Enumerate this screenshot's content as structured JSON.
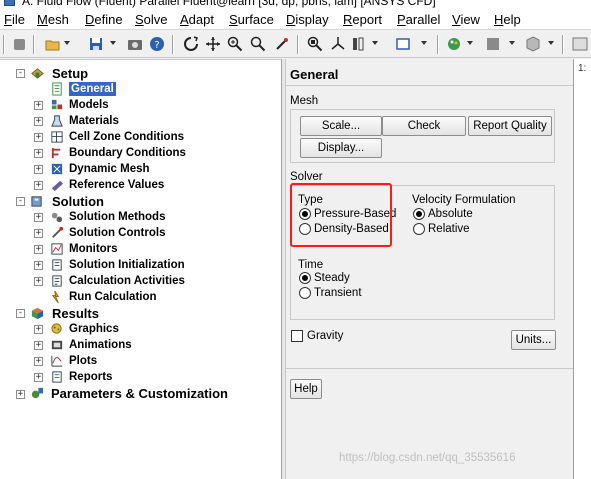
{
  "window": {
    "title": "A: Fluid Flow (Fluent) Parallel Fluent@learn [3d, dp, pbns, lam] [ANSYS CFD]"
  },
  "menubar": {
    "items": [
      {
        "label": "File",
        "ul": "F",
        "rest": "ile"
      },
      {
        "label": "Mesh",
        "ul": "M",
        "rest": "esh"
      },
      {
        "label": "Define",
        "ul": "D",
        "rest": "efine"
      },
      {
        "label": "Solve",
        "ul": "S",
        "rest": "olve"
      },
      {
        "label": "Adapt",
        "ul": "A",
        "rest": "dapt"
      },
      {
        "label": "Surface",
        "ul": "S",
        "rest": "urface"
      },
      {
        "label": "Display",
        "ul": "D",
        "rest": "isplay"
      },
      {
        "label": "Report",
        "ul": "R",
        "rest": "eport"
      },
      {
        "label": "Parallel",
        "ul": "P",
        "rest": "arallel"
      },
      {
        "label": "View",
        "ul": "V",
        "rest": "iew"
      },
      {
        "label": "Help",
        "ul": "H",
        "rest": "elp"
      }
    ]
  },
  "tree": {
    "setup": {
      "label": "Setup",
      "children": [
        "General",
        "Models",
        "Materials",
        "Cell Zone Conditions",
        "Boundary Conditions",
        "Dynamic Mesh",
        "Reference Values"
      ]
    },
    "solution": {
      "label": "Solution",
      "children": [
        "Solution Methods",
        "Solution Controls",
        "Monitors",
        "Solution Initialization",
        "Calculation Activities",
        "Run Calculation"
      ]
    },
    "results": {
      "label": "Results",
      "children": [
        "Graphics",
        "Animations",
        "Plots",
        "Reports"
      ]
    },
    "parameters": {
      "label": "Parameters & Customization"
    },
    "selected": "General"
  },
  "panel": {
    "title": "General",
    "mesh": {
      "label": "Mesh",
      "scale_button": "Scale...",
      "check_button": "Check",
      "report_quality_button": "Report Quality",
      "display_button": "Display..."
    },
    "solver": {
      "label": "Solver",
      "type": {
        "label": "Type",
        "options": [
          "Pressure-Based",
          "Density-Based"
        ],
        "selected": "Pressure-Based"
      },
      "velocity": {
        "label": "Velocity Formulation",
        "options": [
          "Absolute",
          "Relative"
        ],
        "selected": "Absolute"
      },
      "time": {
        "label": "Time",
        "options": [
          "Steady",
          "Transient"
        ],
        "selected": "Steady"
      }
    },
    "gravity_label": "Gravity",
    "gravity_checked": false,
    "units_button": "Units...",
    "help_button": "Help"
  },
  "sliver": {
    "tab": "1:"
  },
  "watermark": "https://blog.csdn.net/qq_35535616",
  "colors": {
    "selection": "#3366cc",
    "highlight_box": "#ff1a1a"
  }
}
